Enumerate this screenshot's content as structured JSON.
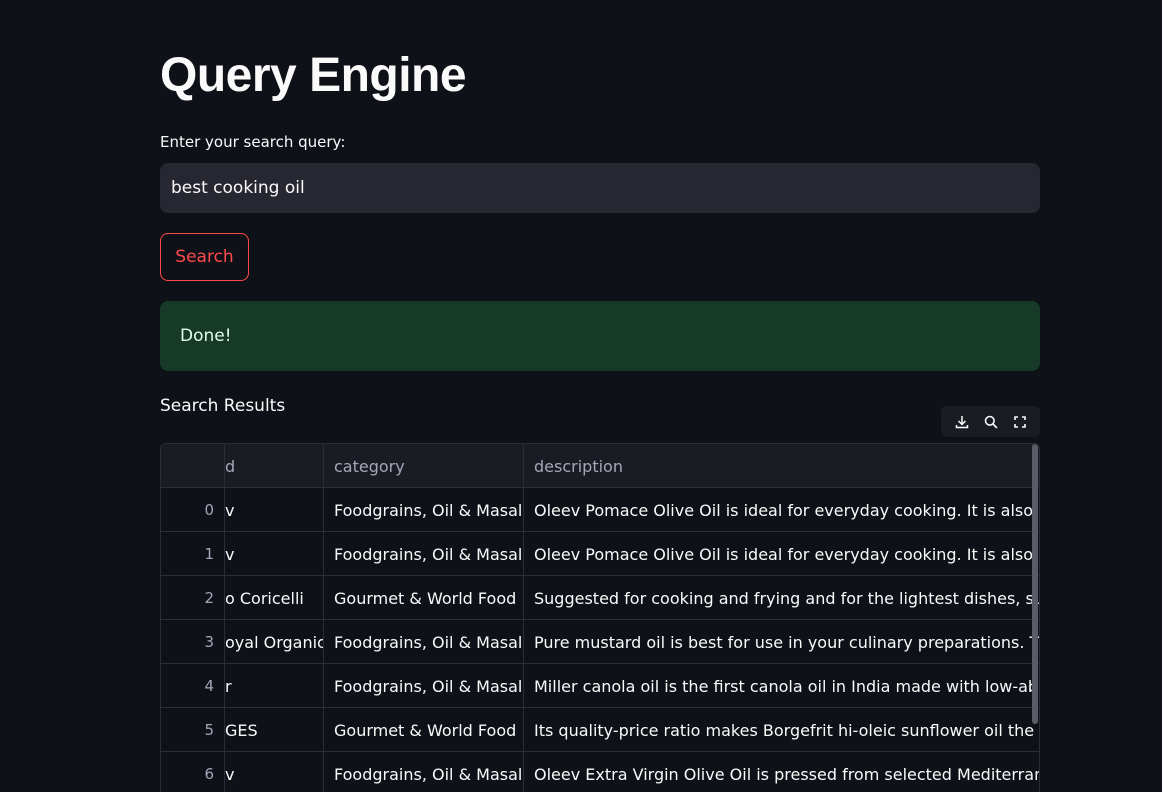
{
  "app": {
    "title": "Query Engine"
  },
  "search": {
    "label": "Enter your search query:",
    "value": "best cooking oil",
    "button_label": "Search"
  },
  "status": {
    "message": "Done!"
  },
  "results": {
    "heading": "Search Results",
    "toolbar_icons": [
      "download-icon",
      "search-icon",
      "fullscreen-icon"
    ],
    "columns": [
      "",
      "d",
      "category",
      "description"
    ],
    "rows": [
      {
        "idx": "0",
        "name": "v",
        "category": "Foodgrains, Oil & Masala",
        "description": "Oleev Pomace Olive Oil is ideal for everyday cooking. It is also suitable"
      },
      {
        "idx": "1",
        "name": "v",
        "category": "Foodgrains, Oil & Masala",
        "description": "Oleev Pomace Olive Oil is ideal for everyday cooking. It is also suitable"
      },
      {
        "idx": "2",
        "name": "o Coricelli",
        "category": "Gourmet & World Food",
        "description": "Suggested for cooking and frying and for the lightest dishes, such as g"
      },
      {
        "idx": "3",
        "name": "oyal Organic",
        "category": "Foodgrains, Oil & Masala",
        "description": "Pure mustard oil is best for use in your culinary preparations. This pure"
      },
      {
        "idx": "4",
        "name": "r",
        "category": "Foodgrains, Oil & Masala",
        "description": "Miller canola oil is the first canola oil in India made with low-absorptio"
      },
      {
        "idx": "5",
        "name": "GES",
        "category": "Gourmet & World Food",
        "description": "Its quality-price ratio makes Borgefrit hi-oleic sunflower oil the most s"
      },
      {
        "idx": "6",
        "name": "v",
        "category": "Foodgrains, Oil & Masala",
        "description": "Oleev Extra Virgin Olive Oil is pressed from selected Mediterranean oliv"
      }
    ]
  },
  "colors": {
    "background": "#0e1117",
    "accent": "#ff4b4b",
    "success_bg": "#173928",
    "input_bg": "#262730"
  }
}
